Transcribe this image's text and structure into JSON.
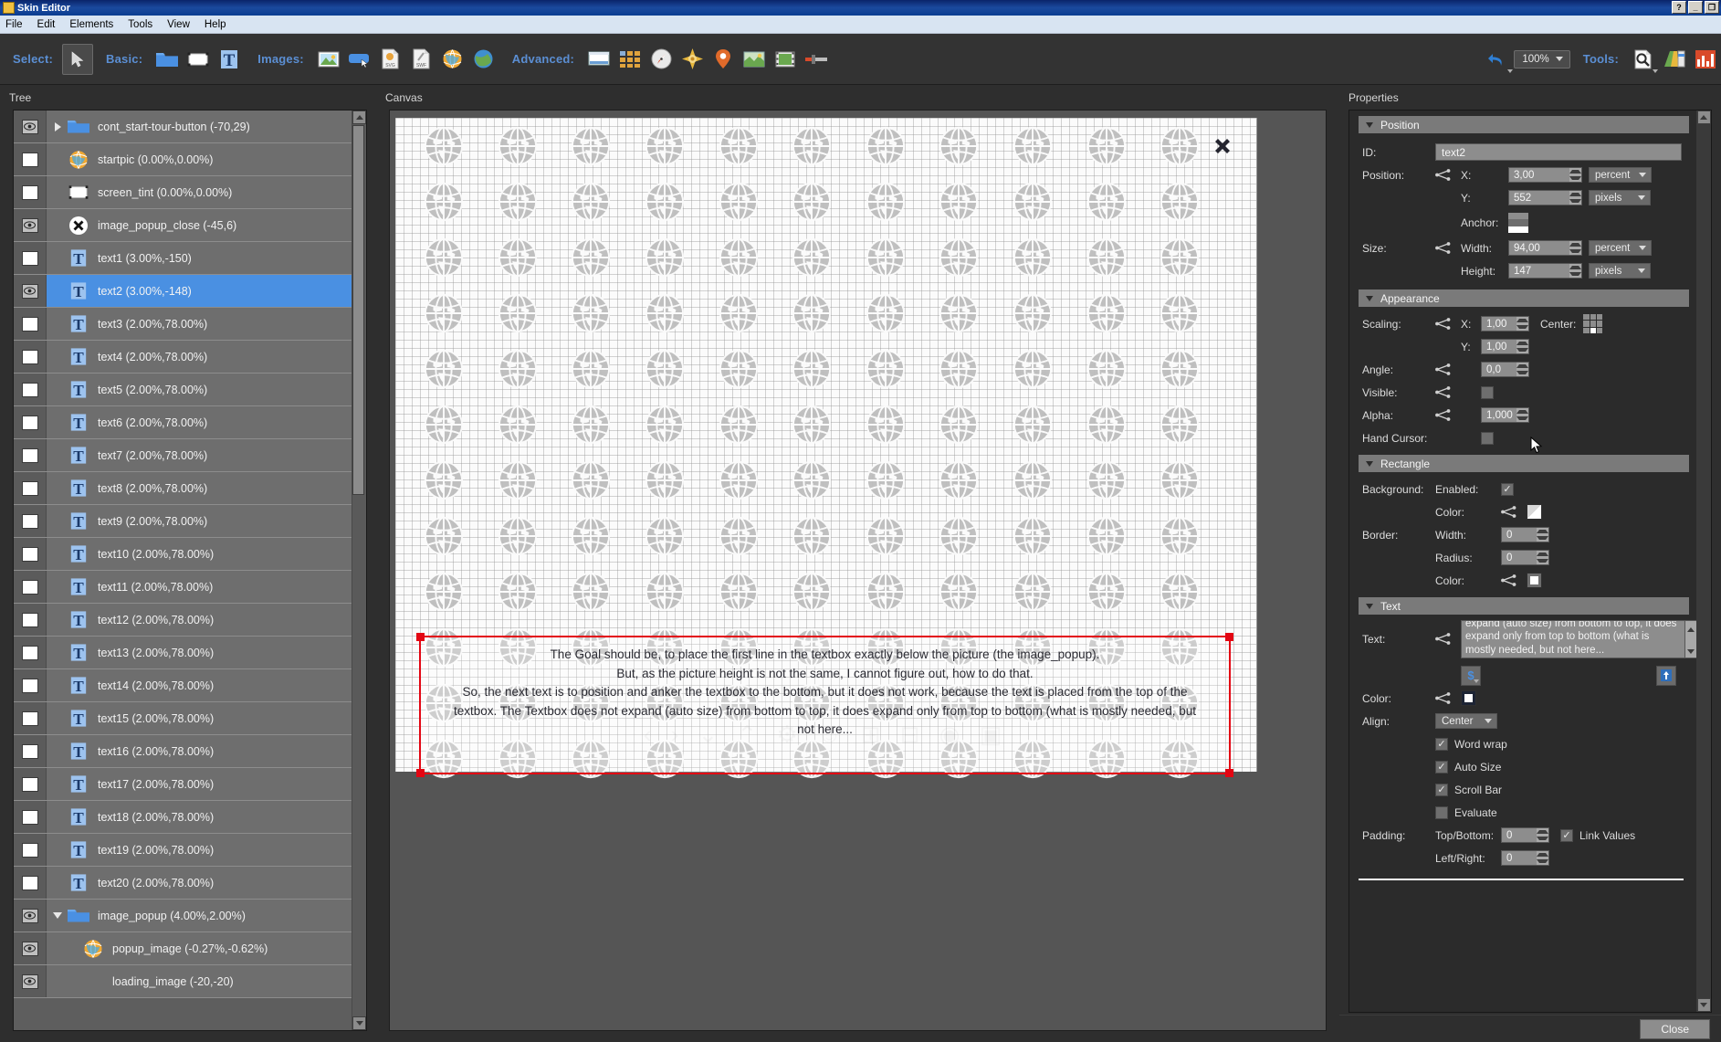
{
  "window": {
    "title": "Skin Editor",
    "controls": [
      "?",
      "_",
      "❐"
    ]
  },
  "menubar": {
    "items": [
      "File",
      "Edit",
      "Elements",
      "Tools",
      "View",
      "Help"
    ]
  },
  "toolbar": {
    "groups": [
      {
        "label": "Select:",
        "icons": [
          "arrow-cursor-icon"
        ]
      },
      {
        "label": "Basic:",
        "icons": [
          "folder-icon",
          "rectangle-icon",
          "text-icon"
        ]
      },
      {
        "label": "Images:",
        "icons": [
          "image-icon",
          "button-icon",
          "svg-file-icon",
          "swf-file-icon",
          "globe-icon",
          "globe-green-icon"
        ]
      },
      {
        "label": "Advanced:",
        "icons": [
          "panel-icon",
          "grid-icon",
          "compass-icon",
          "radar-icon",
          "map-marker-icon",
          "map-icon",
          "filmstrip-icon",
          "slider-icon"
        ]
      }
    ],
    "undo_icon": "undo-icon",
    "zoom": "100%",
    "tools_label": "Tools:",
    "tools_icons": [
      "magnifier-doc-icon",
      "palette-icon",
      "chart-icon"
    ]
  },
  "tree": {
    "title": "Tree",
    "items": [
      {
        "label": "cont_start-tour-button (-70,29)",
        "icon": "folder-icon",
        "visible": true,
        "expander": "collapsed",
        "indent": 0,
        "selected": false
      },
      {
        "label": "startpic (0.00%,0.00%)",
        "icon": "globe-icon",
        "visible": false,
        "expander": "none",
        "indent": 1,
        "selected": false
      },
      {
        "label": "screen_tint (0.00%,0.00%)",
        "icon": "rectangle-icon",
        "visible": false,
        "expander": "none",
        "indent": 1,
        "selected": false
      },
      {
        "label": "image_popup_close (-45,6)",
        "icon": "close-circle-icon",
        "visible": true,
        "expander": "none",
        "indent": 1,
        "selected": false
      },
      {
        "label": "text1 (3.00%,-150)",
        "icon": "text-icon",
        "visible": false,
        "expander": "none",
        "indent": 1,
        "selected": false
      },
      {
        "label": "text2 (3.00%,-148)",
        "icon": "text-icon",
        "visible": true,
        "expander": "none",
        "indent": 1,
        "selected": true
      },
      {
        "label": "text3 (2.00%,78.00%)",
        "icon": "text-icon",
        "visible": false,
        "expander": "none",
        "indent": 1,
        "selected": false
      },
      {
        "label": "text4 (2.00%,78.00%)",
        "icon": "text-icon",
        "visible": false,
        "expander": "none",
        "indent": 1,
        "selected": false
      },
      {
        "label": "text5 (2.00%,78.00%)",
        "icon": "text-icon",
        "visible": false,
        "expander": "none",
        "indent": 1,
        "selected": false
      },
      {
        "label": "text6 (2.00%,78.00%)",
        "icon": "text-icon",
        "visible": false,
        "expander": "none",
        "indent": 1,
        "selected": false
      },
      {
        "label": "text7 (2.00%,78.00%)",
        "icon": "text-icon",
        "visible": false,
        "expander": "none",
        "indent": 1,
        "selected": false
      },
      {
        "label": "text8 (2.00%,78.00%)",
        "icon": "text-icon",
        "visible": false,
        "expander": "none",
        "indent": 1,
        "selected": false
      },
      {
        "label": "text9 (2.00%,78.00%)",
        "icon": "text-icon",
        "visible": false,
        "expander": "none",
        "indent": 1,
        "selected": false
      },
      {
        "label": "text10 (2.00%,78.00%)",
        "icon": "text-icon",
        "visible": false,
        "expander": "none",
        "indent": 1,
        "selected": false
      },
      {
        "label": "text11 (2.00%,78.00%)",
        "icon": "text-icon",
        "visible": false,
        "expander": "none",
        "indent": 1,
        "selected": false
      },
      {
        "label": "text12 (2.00%,78.00%)",
        "icon": "text-icon",
        "visible": false,
        "expander": "none",
        "indent": 1,
        "selected": false
      },
      {
        "label": "text13 (2.00%,78.00%)",
        "icon": "text-icon",
        "visible": false,
        "expander": "none",
        "indent": 1,
        "selected": false
      },
      {
        "label": "text14 (2.00%,78.00%)",
        "icon": "text-icon",
        "visible": false,
        "expander": "none",
        "indent": 1,
        "selected": false
      },
      {
        "label": "text15 (2.00%,78.00%)",
        "icon": "text-icon",
        "visible": false,
        "expander": "none",
        "indent": 1,
        "selected": false
      },
      {
        "label": "text16 (2.00%,78.00%)",
        "icon": "text-icon",
        "visible": false,
        "expander": "none",
        "indent": 1,
        "selected": false
      },
      {
        "label": "text17 (2.00%,78.00%)",
        "icon": "text-icon",
        "visible": false,
        "expander": "none",
        "indent": 1,
        "selected": false
      },
      {
        "label": "text18 (2.00%,78.00%)",
        "icon": "text-icon",
        "visible": false,
        "expander": "none",
        "indent": 1,
        "selected": false
      },
      {
        "label": "text19 (2.00%,78.00%)",
        "icon": "text-icon",
        "visible": false,
        "expander": "none",
        "indent": 1,
        "selected": false
      },
      {
        "label": "text20 (2.00%,78.00%)",
        "icon": "text-icon",
        "visible": false,
        "expander": "none",
        "indent": 1,
        "selected": false
      },
      {
        "label": "image_popup (4.00%,2.00%)",
        "icon": "folder-icon",
        "visible": true,
        "expander": "expanded",
        "indent": 0,
        "selected": false
      },
      {
        "label": "popup_image (-0.27%,-0.62%)",
        "icon": "globe-icon",
        "visible": true,
        "expander": "none",
        "indent": 2,
        "selected": false
      },
      {
        "label": "loading_image (-20,-20)",
        "icon": "none",
        "visible": true,
        "expander": "none",
        "indent": 2,
        "selected": false
      }
    ]
  },
  "canvas": {
    "title": "Canvas",
    "close_icon": "close-x-icon",
    "textbox_lines": [
      "The Goal should be, to place the first line in the textbox exactly below the picture (the image_popup).",
      "But, as the picture height is not the same, I cannot figure out, how to do that.",
      "So, the next text is to position and anker the textbox to the bottom, but it does not work, because the text is placed from the top of the",
      "textbox. The Textbox does not expand (auto size) from bottom to top, it does expand only from top to bottom (what is mostly needed, but",
      "not here..."
    ]
  },
  "properties": {
    "title": "Properties",
    "position": {
      "header": "Position",
      "id_label": "ID:",
      "id_value": "text2",
      "position_label": "Position:",
      "x_label": "X:",
      "x_value": "3,00",
      "x_unit": "percent",
      "y_label": "Y:",
      "y_value": "552",
      "y_unit": "pixels",
      "anchor_label": "Anchor:",
      "size_label": "Size:",
      "width_label": "Width:",
      "width_value": "94,00",
      "width_unit": "percent",
      "height_label": "Height:",
      "height_value": "147",
      "height_unit": "pixels"
    },
    "appearance": {
      "header": "Appearance",
      "scaling_label": "Scaling:",
      "scale_x_label": "X:",
      "scale_x_value": "1,00",
      "scale_y_label": "Y:",
      "scale_y_value": "1,00",
      "center_label": "Center:",
      "angle_label": "Angle:",
      "angle_value": "0,0",
      "visible_label": "Visible:",
      "alpha_label": "Alpha:",
      "alpha_value": "1,000",
      "hand_cursor_label": "Hand Cursor:"
    },
    "rectangle": {
      "header": "Rectangle",
      "background_label": "Background:",
      "enabled_label": "Enabled:",
      "enabled_checked": true,
      "bg_color_label": "Color:",
      "border_label": "Border:",
      "border_width_label": "Width:",
      "border_width_value": "0",
      "border_radius_label": "Radius:",
      "border_radius_value": "0",
      "border_color_label": "Color:"
    },
    "text": {
      "header": "Text",
      "text_label": "Text:",
      "text_value": "top of the textbox. The Textbox does not expand (auto size) from bottom to top, it does expand only from top to bottom (what is mostly needed, but not here...",
      "variable_icon": "dollar-variable-icon",
      "font-icon": "font-upload-icon",
      "color_label": "Color:",
      "align_label": "Align:",
      "align_value": "Center",
      "word_wrap_label": "Word wrap",
      "word_wrap_checked": true,
      "auto_size_label": "Auto Size",
      "auto_size_checked": true,
      "scroll_bar_label": "Scroll Bar",
      "scroll_bar_checked": true,
      "evaluate_label": "Evaluate",
      "evaluate_checked": false,
      "padding_label": "Padding:",
      "top_bottom_label": "Top/Bottom:",
      "top_bottom_value": "0",
      "link_values_label": "Link Values",
      "link_values_checked": true,
      "left_right_label": "Left/Right:",
      "left_right_value": "0"
    }
  },
  "footer": {
    "close_label": "Close"
  },
  "colors": {
    "accent_blue": "#5b8fd4",
    "selection_blue": "#4a90e2",
    "selection_red": "#e30613",
    "panel_bg": "#2e2e2e",
    "toolbar_bg": "#333333",
    "tree_row_bg": "#6e6e6e"
  }
}
